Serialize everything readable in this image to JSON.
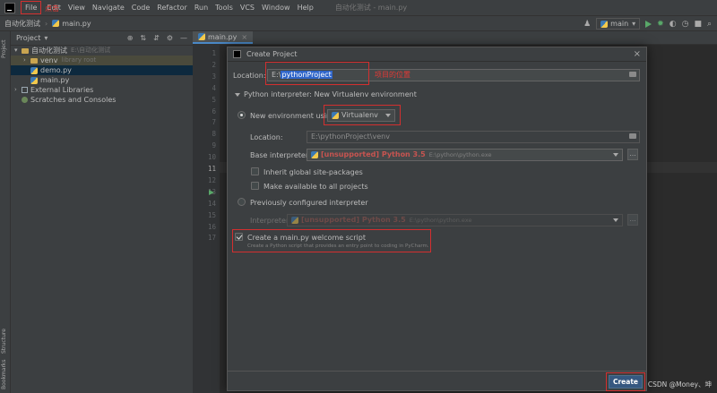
{
  "menu": {
    "items": [
      "File",
      "Edit",
      "View",
      "Navigate",
      "Code",
      "Refactor",
      "Run",
      "Tools",
      "VCS",
      "Window",
      "Help"
    ],
    "window_title": "自动化测试 - main.py",
    "click_annotation": "点击"
  },
  "navbar": {
    "project": "自动化测试",
    "file": "main.py",
    "run_config": "main"
  },
  "stripe": {
    "project": "Project",
    "structure": "Structure",
    "bookmarks": "Bookmarks"
  },
  "project_panel": {
    "title": "Project",
    "root_name": "自动化测试",
    "root_path": "E:\\自动化测试",
    "venv": "venv",
    "venv_hint": "library root",
    "demo": "demo.py",
    "main": "main.py",
    "external": "External Libraries",
    "scratches": "Scratches and Consoles"
  },
  "editor": {
    "tab": "main.py",
    "line_numbers": [
      "1",
      "2",
      "3",
      "4",
      "5",
      "6",
      "7",
      "8",
      "9",
      "10",
      "11",
      "12",
      "13",
      "14",
      "15",
      "16",
      "17"
    ]
  },
  "dialog": {
    "title": "Create Project",
    "location_label": "Location:",
    "location_prefix": "E:\\",
    "location_selected": "pythonProject",
    "location_annotation": "项目的位置",
    "interpreter_section": "Python interpreter: New Virtualenv environment",
    "new_env_label": "New environment using",
    "env_tool": "Virtualenv",
    "env_location_label": "Location:",
    "env_location_value": "E:\\pythonProject\\venv",
    "base_label": "Base interpreter:",
    "base_tag": "[unsupported] Python 3.5",
    "base_path": "E:\\python\\python.exe",
    "inherit_label": "Inherit global site-packages",
    "available_label": "Make available to all projects",
    "previous_label": "Previously configured interpreter",
    "interp_label": "Interpreter:",
    "interp_tag": "[unsupported] Python 3.5",
    "interp_path": "E:\\python\\python.exe",
    "welcome_label": "Create a main.py welcome script",
    "welcome_desc": "Create a Python script that provides an entry point to coding in PyCharm.",
    "create_button": "Create"
  },
  "watermark": "CSDN @Money、坤"
}
